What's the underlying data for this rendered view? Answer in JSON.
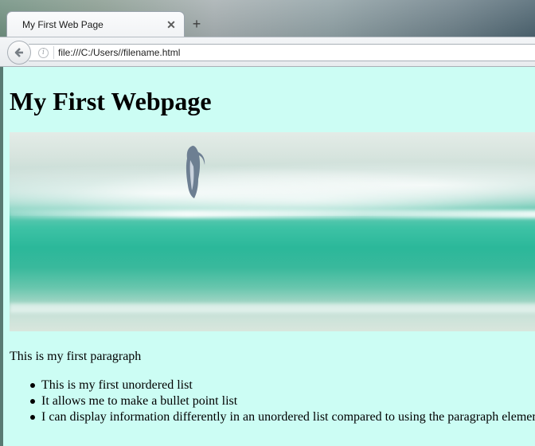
{
  "window": {
    "tab_title": "My First Web Page",
    "tab_close_icon": "close-icon",
    "new_tab_symbol": "+"
  },
  "toolbar": {
    "back_icon": "back-arrow-icon",
    "info_icon": "info-icon",
    "url": "file:///C:/Users//filename.html"
  },
  "page": {
    "heading": "My First Webpage",
    "image_description": "dolphin-wave-photo",
    "paragraph": "This is my first paragraph",
    "list_items": [
      "This is my first unordered list",
      "It allows me to make a bullet point list",
      "I can display information differently in an unordered list compared to using the paragraph element"
    ],
    "background_color": "#ccfdf4"
  }
}
